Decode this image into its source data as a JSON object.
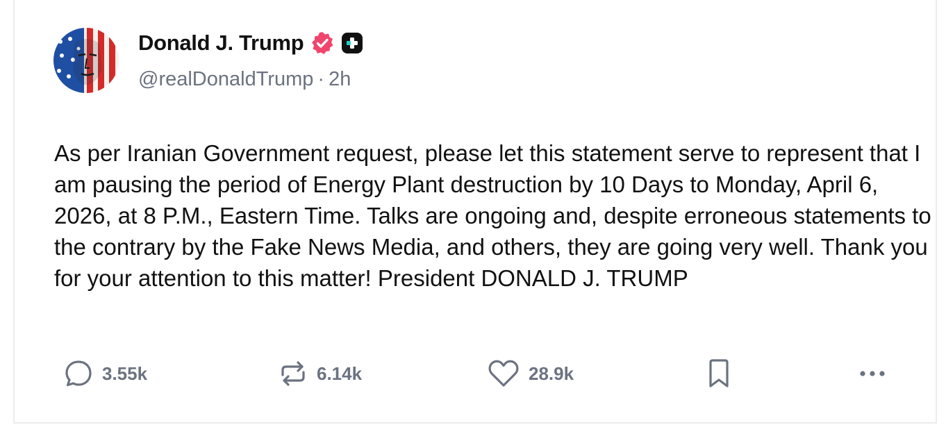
{
  "post": {
    "author": {
      "display_name": "Donald J. Trump",
      "handle": "@realDonaldTrump",
      "separator": "·",
      "time": "2h",
      "avatar_icon": "american-flag-portrait-avatar",
      "verified_icon": "verified-badge-icon",
      "verified_color": "#f0456d",
      "plus_icon": "plus-badge-icon"
    },
    "text": "As per Iranian Government request, please let this statement serve to represent that I am pausing the period of Energy Plant destruction by 10 Days to Monday, April 6, 2026, at 8 P.M., Eastern Time. Talks are ongoing and, despite erroneous statements to the contrary by the Fake News Media, and others, they are going very well. Thank you for your attention to this matter! President DONALD J. TRUMP",
    "actions": {
      "replies": {
        "icon": "reply-icon",
        "count": "3.55k"
      },
      "reposts": {
        "icon": "repost-icon",
        "count": "6.14k"
      },
      "likes": {
        "icon": "heart-icon",
        "count": "28.9k"
      },
      "bookmark": {
        "icon": "bookmark-icon"
      },
      "more": {
        "icon": "more-icon"
      }
    },
    "colors": {
      "text_primary": "#111111",
      "text_secondary": "#6b7280",
      "border": "#ececf0"
    }
  }
}
